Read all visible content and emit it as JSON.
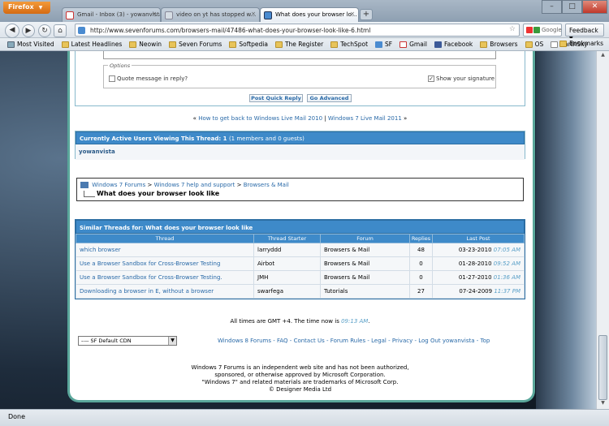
{
  "browser": {
    "menu_button": "Firefox",
    "tabs": [
      {
        "label": "Gmail - Inbox (3) - yowanvista@...",
        "active": false
      },
      {
        "label": "video on yt has stopped w...",
        "active": false
      },
      {
        "label": "What does your browser lo...",
        "active": true
      }
    ],
    "url": "http://www.sevenforums.com/browsers-mail/47486-what-does-your-browser-look-like-6.html",
    "search_engine": "Google",
    "feedback_label": "Feedback",
    "bookmarks": [
      "Most Visited",
      "Latest Headlines",
      "Neowin",
      "Seven Forums",
      "Softpedia",
      "The Register",
      "TechSpot",
      "SF",
      "Gmail",
      "Facebook",
      "Browsers",
      "OS",
      "EarthSky"
    ],
    "bookmarks_menu": "Bookmarks",
    "status": "Done"
  },
  "quick_reply": {
    "options_legend": "Options",
    "quote_label": "Quote message in reply?",
    "signature_label": "Show your signature",
    "post_button": "Post Quick Reply",
    "advanced_button": "Go Advanced"
  },
  "thread_nav": {
    "prev": "How to get back to Windows Live Mail 2010",
    "sep": "|",
    "next": "Windows 7 Live Mail 2011",
    "left_guillemet": "«",
    "right_guillemet": "»"
  },
  "active_users": {
    "header": "Currently Active Users Viewing This Thread: 1",
    "header_sub": "(1 members and 0 guests)",
    "users": [
      "yowanvista"
    ]
  },
  "breadcrumb": {
    "items": [
      "Windows 7 Forums",
      "Windows 7 help and support",
      "Browsers & Mail"
    ],
    "separator": ">",
    "current": "What does your browser look like"
  },
  "similar_threads": {
    "header": "Similar Threads for: What does your browser look like",
    "columns": [
      "Thread",
      "Thread Starter",
      "Forum",
      "Replies",
      "Last Post"
    ],
    "rows": [
      {
        "thread": "which browser",
        "starter": "larryddd",
        "forum": "Browsers & Mail",
        "replies": "48",
        "date": "03-23-2010",
        "time": "07:05 AM"
      },
      {
        "thread": "Use a Browser Sandbox for Cross-Browser Testing",
        "starter": "Airbot",
        "forum": "Browsers & Mail",
        "replies": "0",
        "date": "01-28-2010",
        "time": "09:52 AM"
      },
      {
        "thread": "Use a Browser Sandbox for Cross-Browser Testing.",
        "starter": "JMH",
        "forum": "Browsers & Mail",
        "replies": "0",
        "date": "01-27-2010",
        "time": "01:36 AM"
      },
      {
        "thread": "Downloading a browser in E, without a browser",
        "starter": "swarfega",
        "forum": "Tutorials",
        "replies": "27",
        "date": "07-24-2009",
        "time": "11:37 PM"
      }
    ]
  },
  "footer": {
    "time_prefix": "All times are GMT +4. The time now is",
    "time_now": "09:13 AM",
    "time_suffix": ".",
    "style_select": "---- SF Default CDN",
    "links": [
      "Windows 8 Forums",
      "FAQ",
      "Contact Us",
      "Forum Rules",
      "Legal",
      "Privacy",
      "Log Out yowanvista",
      "Top"
    ],
    "link_sep": "-",
    "disclaimer": [
      "Windows 7 Forums is an independent web site and has not been authorized,",
      "sponsored, or otherwise approved by Microsoft Corporation.",
      "\"Windows 7\" and related materials are trademarks of Microsoft Corp.",
      "© Designer Media Ltd"
    ]
  }
}
